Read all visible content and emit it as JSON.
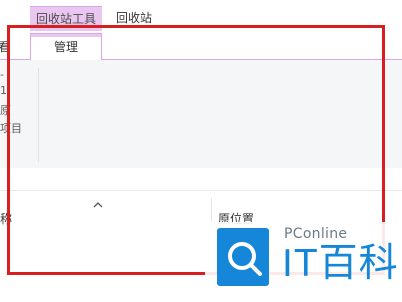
{
  "titlebar": {
    "context_tab_header": "回收站工具",
    "window_title": "回收站"
  },
  "tabs": {
    "partial_left": "看",
    "manage": "管理"
  },
  "ribbon": {
    "left_fragments": [
      "-",
      "1",
      "原",
      "项目"
    ]
  },
  "columns": {
    "name_partial": "称",
    "original_location": "原位置"
  },
  "watermark": {
    "brand_small": "PConline",
    "brand_large": "IT百科"
  },
  "colors": {
    "context_accent": "#e9c7f0",
    "highlight_border": "#d81e1e",
    "watermark_blue": "#1686d9"
  }
}
